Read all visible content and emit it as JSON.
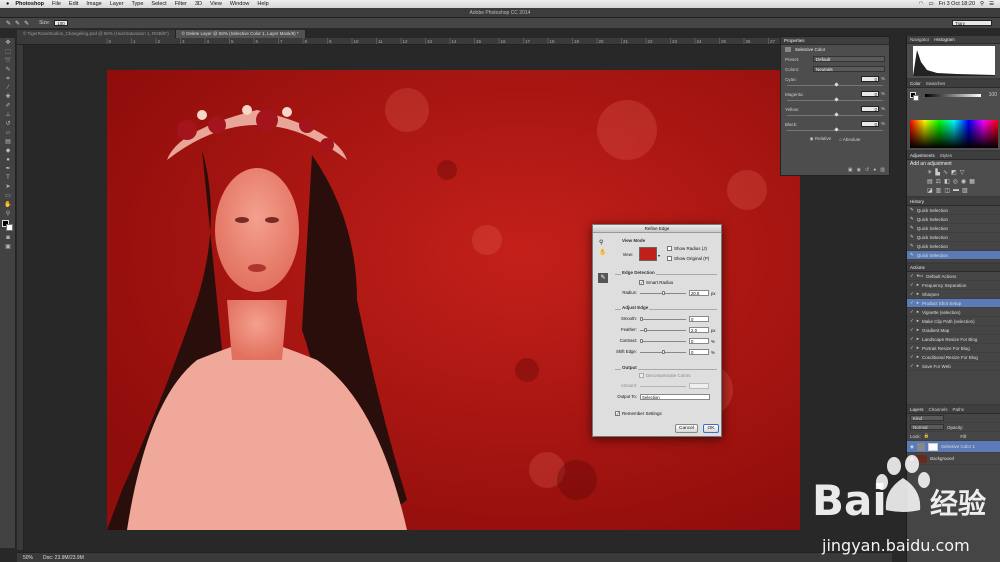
{
  "menubar": {
    "app": "Photoshop",
    "items": [
      "File",
      "Edit",
      "Image",
      "Layer",
      "Type",
      "Select",
      "Filter",
      "3D",
      "View",
      "Window",
      "Help"
    ],
    "clock": "Fri 3 Oct 18:20"
  },
  "window": {
    "title": "Adobe Photoshop CC 2014"
  },
  "options": {
    "size_label": "Size:",
    "size_value": "100",
    "workspace": "Tigry"
  },
  "tabs": [
    {
      "label": "© TigerRoseStudios_Changeling.psd @ 50% (Hue/Saturation 1, RGB/8*)"
    },
    {
      "label": "© Delete Layer @ 50% (Selective Color 1, Layer Mask/8) *"
    }
  ],
  "ruler_ticks": [
    "0",
    "1",
    "2",
    "3",
    "4",
    "5",
    "6",
    "7",
    "8",
    "9",
    "10",
    "11",
    "12",
    "13",
    "14",
    "15",
    "16",
    "17",
    "18",
    "19",
    "20",
    "21",
    "22",
    "23",
    "24",
    "25",
    "26",
    "27",
    "28"
  ],
  "status": {
    "zoom": "50%",
    "doc": "Doc: 23.9M/23.9M"
  },
  "properties": {
    "tabs": [
      "Properties"
    ],
    "title": "Selective Color",
    "preset_label": "Preset:",
    "preset_value": "Default",
    "colors_label": "Colors:",
    "colors_value": "Neutrals",
    "rows": [
      {
        "label": "Cyan:",
        "value": "0",
        "unit": "%"
      },
      {
        "label": "Magenta:",
        "value": "0",
        "unit": "%"
      },
      {
        "label": "Yellow:",
        "value": "0",
        "unit": "%"
      },
      {
        "label": "Black:",
        "value": "0",
        "unit": "%"
      }
    ],
    "relative": "Relative",
    "absolute": "Absolute"
  },
  "navigator": {
    "tabs": [
      "Navigator",
      "Histogram"
    ]
  },
  "color": {
    "tabs": [
      "Color",
      "Swatches"
    ],
    "value": "100"
  },
  "adjustments": {
    "tabs": [
      "Adjustments",
      "Styles"
    ],
    "hint": "Add an adjustment"
  },
  "history": {
    "tab": "History",
    "items": [
      "Quick Selection",
      "Quick Selection",
      "Quick Selection",
      "Quick Selection",
      "Quick Selection",
      "Quick Selection"
    ]
  },
  "actions": {
    "tab": "Actions",
    "items": [
      "Default Actions",
      "Frequency Separation",
      "Sharpen",
      "Product Shot Setup",
      "Vignette (selection)",
      "Make Clip Path (selection)",
      "Gradient Map",
      "Landscape Resize For Blog",
      "Portrait Resize For Blog",
      "Conditional Resize For Blog",
      "Save For Web"
    ]
  },
  "layers": {
    "tabs": [
      "Layers",
      "Channels",
      "Paths"
    ],
    "kind": "Kind",
    "blend": "Normal",
    "opacity_label": "Opacity:",
    "lock_label": "Lock:",
    "fill_label": "Fill:",
    "items": [
      "Selective Color 1",
      "Background"
    ]
  },
  "dialog": {
    "title": "Refine Edge",
    "view_mode": "View Mode",
    "view_label": "View:",
    "show_radius": "Show Radius (J)",
    "show_original": "Show Original (P)",
    "edge_detection": "Edge Detection",
    "smart_radius": "Smart Radius",
    "radius_label": "Radius:",
    "radius_value": "20.8",
    "radius_unit": "px",
    "adjust_edge": "Adjust Edge",
    "smooth_label": "Smooth:",
    "smooth_value": "0",
    "feather_label": "Feather:",
    "feather_value": "2.0",
    "feather_unit": "px",
    "contrast_label": "Contrast:",
    "contrast_value": "0",
    "contrast_unit": "%",
    "shift_label": "Shift Edge:",
    "shift_value": "0",
    "shift_unit": "%",
    "output": "Output",
    "decontam": "Decontaminate Colors",
    "amount_label": "Amount:",
    "output_to_label": "Output To:",
    "output_to_value": "Selection",
    "remember": "Remember Settings",
    "cancel": "Cancel",
    "ok": "OK"
  },
  "watermark": {
    "brand": "Bai",
    "brand2": "经验",
    "url": "jingyan.baidu.com"
  }
}
